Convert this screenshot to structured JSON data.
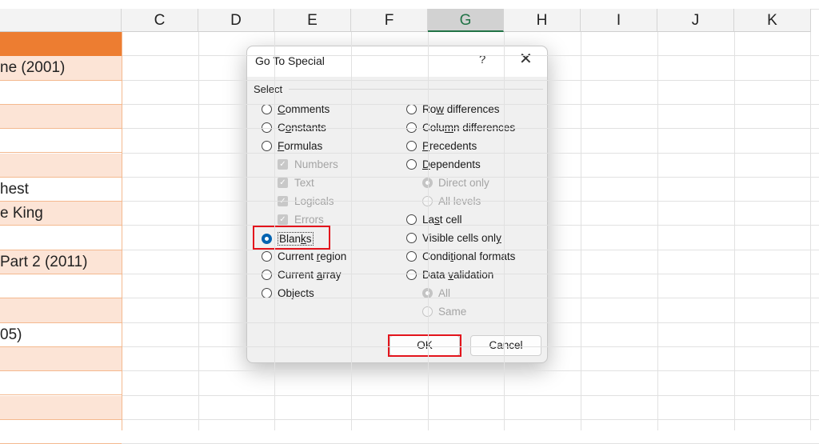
{
  "spreadsheet": {
    "columns": [
      {
        "label": "",
        "selected": false
      },
      {
        "label": "C",
        "selected": false
      },
      {
        "label": "D",
        "selected": false
      },
      {
        "label": "E",
        "selected": false
      },
      {
        "label": "F",
        "selected": false
      },
      {
        "label": "G",
        "selected": true
      },
      {
        "label": "H",
        "selected": false
      },
      {
        "label": "I",
        "selected": false
      },
      {
        "label": "J",
        "selected": false
      },
      {
        "label": "K",
        "selected": false
      }
    ],
    "column_a_cells": [
      "",
      "ne (2001)",
      "",
      "",
      "",
      "",
      "hest",
      "e King",
      "",
      " Part 2 (2011)",
      "",
      "",
      "05)",
      "",
      "",
      "",
      ""
    ],
    "colors": {
      "header_fill": "#ed7d31",
      "band_fill": "#fce4d6",
      "selected_column_accent": "#217346"
    }
  },
  "dialog": {
    "title": "Go To Special",
    "help_label": "?",
    "close_label": "✕",
    "group_label": "Select",
    "left_options": [
      {
        "pre": "",
        "key": "C",
        "post": "omments",
        "state": "off"
      },
      {
        "pre": "C",
        "key": "o",
        "post": "nstants",
        "state": "off"
      },
      {
        "pre": "",
        "key": "F",
        "post": "ormulas",
        "state": "off"
      },
      {
        "pre": "Numbers",
        "key": "",
        "post": "",
        "state": "checkbox-disabled"
      },
      {
        "pre": "Text",
        "key": "",
        "post": "",
        "state": "checkbox-disabled"
      },
      {
        "pre": "Logicals",
        "key": "",
        "post": "",
        "state": "checkbox-disabled"
      },
      {
        "pre": "Errors",
        "key": "",
        "post": "",
        "state": "checkbox-disabled"
      },
      {
        "pre": "Blan",
        "key": "k",
        "post": "s",
        "state": "on"
      },
      {
        "pre": "Current ",
        "key": "r",
        "post": "egion",
        "state": "off"
      },
      {
        "pre": "Current ",
        "key": "a",
        "post": "rray",
        "state": "off"
      },
      {
        "pre": "O",
        "key": "b",
        "post": "jects",
        "state": "off"
      }
    ],
    "right_options": [
      {
        "pre": "Ro",
        "key": "w",
        "post": " differences",
        "state": "off"
      },
      {
        "pre": "Colu",
        "key": "m",
        "post": "n differences",
        "state": "off"
      },
      {
        "pre": "",
        "key": "P",
        "post": "recedents",
        "state": "off"
      },
      {
        "pre": "",
        "key": "D",
        "post": "ependents",
        "state": "off"
      },
      {
        "pre": "Direct only",
        "key": "",
        "post": "",
        "state": "disabled-on"
      },
      {
        "pre": "All levels",
        "key": "",
        "post": "",
        "state": "disabled-off"
      },
      {
        "pre": "La",
        "key": "s",
        "post": "t cell",
        "state": "off"
      },
      {
        "pre": "Visible cells onl",
        "key": "y",
        "post": "",
        "state": "off"
      },
      {
        "pre": "Condi",
        "key": "t",
        "post": "ional formats",
        "state": "off"
      },
      {
        "pre": "Data ",
        "key": "v",
        "post": "alidation",
        "state": "off"
      },
      {
        "pre": "All",
        "key": "",
        "post": "",
        "state": "disabled-on"
      },
      {
        "pre": "Same",
        "key": "",
        "post": "",
        "state": "disabled-off"
      }
    ],
    "ok_label": "OK",
    "cancel_label": "Cancel",
    "highlight_color": "#e3141c",
    "radio_accent": "#0063b1"
  }
}
